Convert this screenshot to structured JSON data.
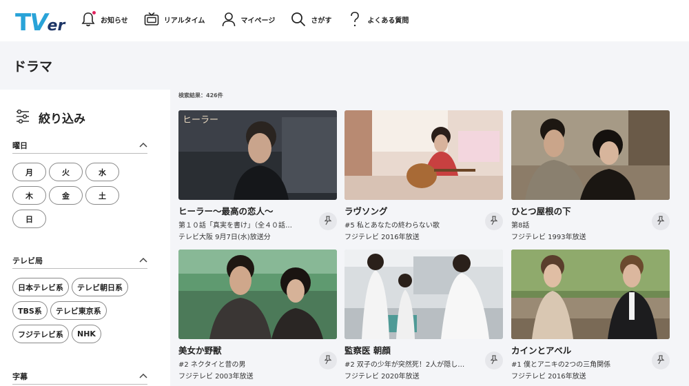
{
  "header": {
    "logo": {
      "t": "T",
      "v": "V",
      "er": "er"
    },
    "nav": [
      {
        "label": "お知らせ",
        "icon": "bell-icon"
      },
      {
        "label": "リアルタイム",
        "icon": "tv-icon"
      },
      {
        "label": "マイページ",
        "icon": "person-icon"
      },
      {
        "label": "さがす",
        "icon": "search-icon"
      },
      {
        "label": "よくある質問",
        "icon": "question-icon"
      }
    ]
  },
  "page": {
    "title": "ドラマ"
  },
  "sidebar": {
    "filter_label": "絞り込み",
    "sections": [
      {
        "label": "曜日",
        "chips": [
          "月",
          "火",
          "水",
          "木",
          "金",
          "土",
          "日"
        ]
      },
      {
        "label": "テレビ局",
        "chips": [
          "日本テレビ系",
          "テレビ朝日系",
          "TBS系",
          "テレビ東京系",
          "フジテレビ系",
          "NHK"
        ]
      },
      {
        "label": "字幕",
        "chips": []
      }
    ]
  },
  "results": {
    "count_text": "検索結果：426件",
    "cards": [
      {
        "title": "ヒーラー〜最高の恋人〜",
        "sub": "第１０話「真実を書け」（全４０話…",
        "meta": "テレビ大阪 9月7日(水)放送分"
      },
      {
        "title": "ラヴソング",
        "sub": "#5 私とあなたの終わらない歌",
        "meta": "フジテレビ 2016年放送"
      },
      {
        "title": "ひとつ屋根の下",
        "sub": "第8話",
        "meta": "フジテレビ 1993年放送"
      },
      {
        "title": "美女か野獣",
        "sub": "#2 ネクタイと昔の男",
        "meta": "フジテレビ 2003年放送"
      },
      {
        "title": "監察医 朝顔",
        "sub": "#2 双子の少年が突然死！2人が隠し…",
        "meta": "フジテレビ 2020年放送"
      },
      {
        "title": "カインとアベル",
        "sub": "#1 僕とアニキの2つの三角関係",
        "meta": "フジテレビ 2016年放送"
      }
    ]
  },
  "colors": {
    "brand_blue": "#29a3d8",
    "brand_navy": "#1d3566",
    "notice_dot": "#e0245e",
    "panel_bg": "#f4f5f8"
  }
}
